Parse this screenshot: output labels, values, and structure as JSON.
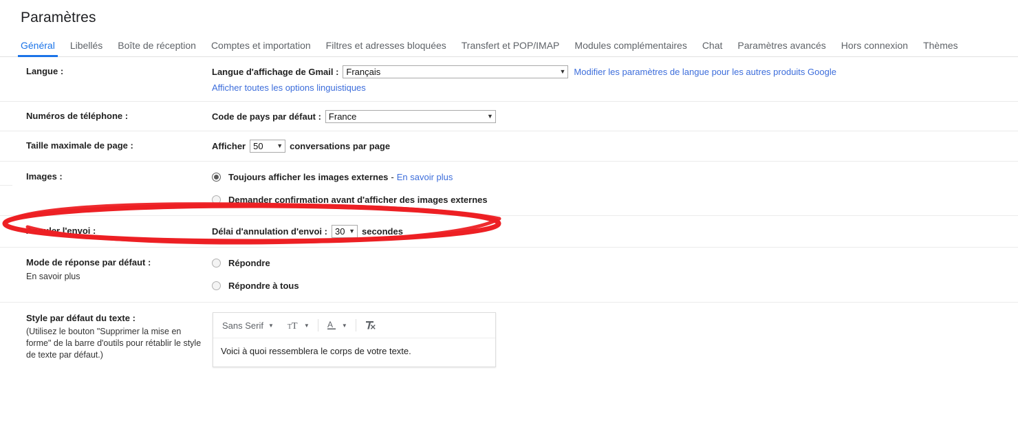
{
  "header": {
    "title": "Paramètres"
  },
  "tabs": [
    {
      "label": "Général",
      "active": true
    },
    {
      "label": "Libellés",
      "active": false
    },
    {
      "label": "Boîte de réception",
      "active": false
    },
    {
      "label": "Comptes et importation",
      "active": false
    },
    {
      "label": "Filtres et adresses bloquées",
      "active": false
    },
    {
      "label": "Transfert et POP/IMAP",
      "active": false
    },
    {
      "label": "Modules complémentaires",
      "active": false
    },
    {
      "label": "Chat",
      "active": false
    },
    {
      "label": "Paramètres avancés",
      "active": false
    },
    {
      "label": "Hors connexion",
      "active": false
    },
    {
      "label": "Thèmes",
      "active": false
    }
  ],
  "settings": {
    "language": {
      "label": "Langue :",
      "field_label": "Langue d'affichage de Gmail :",
      "select_value": "Français",
      "external_link": "Modifier les paramètres de langue pour les autres produits Google",
      "show_all_link": "Afficher toutes les options linguistiques"
    },
    "phone": {
      "label": "Numéros de téléphone :",
      "field_label": "Code de pays par défaut :",
      "select_value": "France"
    },
    "page_size": {
      "label": "Taille maximale de page :",
      "prefix": "Afficher",
      "select_value": "50",
      "suffix": "conversations par page"
    },
    "images": {
      "label": "Images :",
      "option_always": "Toujours afficher les images externes",
      "option_always_selected": true,
      "learn_more_dash": "-",
      "learn_more": "En savoir plus",
      "option_ask": "Demander confirmation avant d'afficher des images externes",
      "option_ask_selected": false
    },
    "undo_send": {
      "label": "Annuler l'envoi :",
      "field_label": "Délai d'annulation d'envoi :",
      "select_value": "30",
      "suffix": "secondes",
      "highlighted": true
    },
    "reply_mode": {
      "label": "Mode de réponse par défaut :",
      "learn_more": "En savoir plus",
      "option_reply": "Répondre",
      "option_reply_selected": false,
      "option_reply_all": "Répondre à tous",
      "option_reply_all_selected": false
    },
    "text_style": {
      "label": "Style par défaut du texte :",
      "hint": "(Utilisez le bouton \"Supprimer la mise en forme\" de la barre d'outils pour rétablir le style de texte par défaut.)",
      "toolbar": {
        "font_name": "Sans Serif",
        "size_icon": "font-size-icon",
        "color_icon": "text-color-icon",
        "clear_format_icon": "remove-formatting-icon"
      },
      "sample_text": "Voici à quoi ressemblera le corps de votre texte."
    }
  },
  "annotation": {
    "shape": "ellipse",
    "color": "#ed2024",
    "target": "Annuler l'envoi"
  },
  "colors": {
    "accent": "#1a73e8",
    "link": "#3c6ddb",
    "annotation_red": "#ed2024",
    "divider": "#ebebeb"
  }
}
